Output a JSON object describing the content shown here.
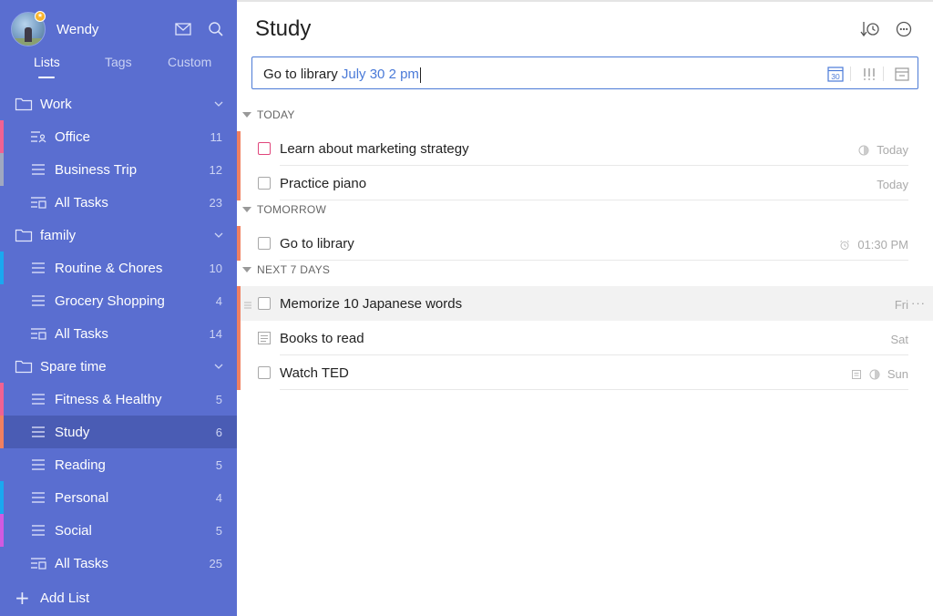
{
  "user": {
    "name": "Wendy",
    "badge": "★"
  },
  "sidebar": {
    "tabs": [
      {
        "label": "Lists",
        "active": true
      },
      {
        "label": "Tags",
        "active": false
      },
      {
        "label": "Custom",
        "active": false
      }
    ],
    "rows": [
      {
        "kind": "folder",
        "label": "Work",
        "icon": "folder-icon"
      },
      {
        "kind": "item",
        "label": "Office",
        "count": "11",
        "icon": "shared-list-icon",
        "color": "#f06292"
      },
      {
        "kind": "item",
        "label": "Business Trip",
        "count": "12",
        "icon": "list-icon",
        "color": "#a0a8c0"
      },
      {
        "kind": "item",
        "label": "All Tasks",
        "count": "23",
        "icon": "all-tasks-icon"
      },
      {
        "kind": "folder",
        "label": "family",
        "icon": "folder-icon"
      },
      {
        "kind": "item",
        "label": "Routine & Chores",
        "count": "10",
        "icon": "list-icon",
        "color": "#1aa8f0"
      },
      {
        "kind": "item",
        "label": "Grocery Shopping",
        "count": "4",
        "icon": "list-icon"
      },
      {
        "kind": "item",
        "label": "All Tasks",
        "count": "14",
        "icon": "all-tasks-icon"
      },
      {
        "kind": "folder",
        "label": "Spare time",
        "icon": "folder-icon"
      },
      {
        "kind": "item",
        "label": "Fitness & Healthy",
        "count": "5",
        "icon": "list-icon",
        "color": "#f06292"
      },
      {
        "kind": "item",
        "label": "Study",
        "count": "6",
        "icon": "list-icon",
        "color": "#f08060",
        "active": true
      },
      {
        "kind": "item",
        "label": "Reading",
        "count": "5",
        "icon": "list-icon"
      },
      {
        "kind": "item",
        "label": "Personal",
        "count": "4",
        "icon": "list-icon",
        "color": "#1aa8f0"
      },
      {
        "kind": "item",
        "label": "Social",
        "count": "5",
        "icon": "list-icon",
        "color": "#d15ae0"
      },
      {
        "kind": "item",
        "label": "All Tasks",
        "count": "25",
        "icon": "all-tasks-icon"
      }
    ],
    "add_list_label": "Add List"
  },
  "main": {
    "title": "Study",
    "add_task": {
      "text": "Go to library",
      "date_text": "July 30 2 pm",
      "calendar_day": "30"
    },
    "sections": [
      {
        "label": "TODAY",
        "tasks": [
          {
            "title": "Learn about marketing strategy",
            "meta": "Today",
            "priority_color": "#f08060",
            "checkbox": "red",
            "icons": [
              "progress-icon"
            ]
          },
          {
            "title": "Practice piano",
            "meta": "Today",
            "priority_color": "#f08060",
            "checkbox": "normal",
            "icons": []
          }
        ]
      },
      {
        "label": "TOMORROW",
        "tasks": [
          {
            "title": "Go to library",
            "meta": "01:30 PM",
            "priority_color": "#f08060",
            "checkbox": "normal",
            "icons": [
              "alarm-icon"
            ]
          }
        ]
      },
      {
        "label": "NEXT 7 DAYS",
        "tasks": [
          {
            "title": "Memorize 10 Japanese words",
            "meta": "Fri",
            "priority_color": "#f08060",
            "checkbox": "normal",
            "icons": [],
            "hover": true,
            "more": "···"
          },
          {
            "title": "Books to read",
            "meta": "Sat",
            "priority_color": "#f08060",
            "checkbox": "note",
            "icons": []
          },
          {
            "title": "Watch TED",
            "meta": "Sun",
            "priority_color": "#f08060",
            "checkbox": "normal",
            "icons": [
              "note-icon",
              "progress-icon"
            ]
          }
        ]
      }
    ]
  }
}
